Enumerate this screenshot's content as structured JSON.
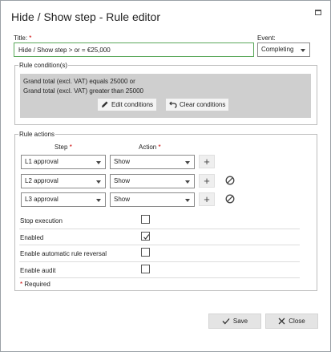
{
  "dialog": {
    "title": "Hide / Show step - Rule editor"
  },
  "form": {
    "title_label": "Title:",
    "required_marker": "*",
    "title_value": "Hide / Show step > or = €25,000",
    "event_label": "Event:",
    "event_value": "Completing"
  },
  "conditions": {
    "legend": "Rule condition(s)",
    "lines": [
      "Grand total (excl. VAT) equals 25000 or",
      "Grand total (excl. VAT) greater than 25000"
    ],
    "edit_label": "Edit conditions",
    "clear_label": "Clear conditions"
  },
  "actions": {
    "legend": "Rule actions",
    "step_header": "Step",
    "action_header": "Action",
    "rows": [
      {
        "step": "L1 approval",
        "action": "Show"
      },
      {
        "step": "L2 approval",
        "action": "Show"
      },
      {
        "step": "L3 approval",
        "action": "Show"
      }
    ]
  },
  "options": {
    "stop_execution": {
      "label": "Stop execution",
      "checked": false
    },
    "enabled": {
      "label": "Enabled",
      "checked": true
    },
    "auto_reversal": {
      "label": "Enable automatic rule reversal",
      "checked": false
    },
    "audit": {
      "label": "Enable audit",
      "checked": false
    },
    "required_note": "Required"
  },
  "footer": {
    "save_label": "Save",
    "close_label": "Close"
  },
  "icons": [
    "maximize-icon",
    "pencil-icon",
    "undo-icon",
    "plus-icon",
    "block-icon",
    "check-icon",
    "close-icon",
    "chevron-down-icon"
  ]
}
